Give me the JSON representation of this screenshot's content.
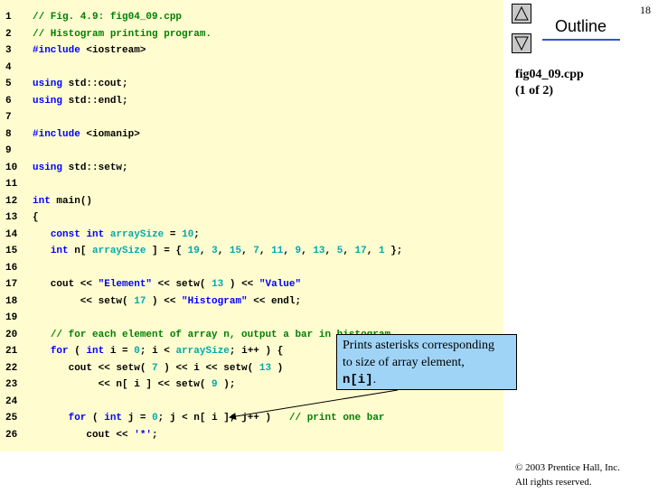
{
  "page_number": "18",
  "outline": {
    "title": "Outline",
    "up_icon": "triangle-up-icon",
    "down_icon": "triangle-down-icon",
    "file": "fig04_09.cpp",
    "part": "(1 of 2)"
  },
  "code_lines": [
    {
      "n": "1",
      "tokens": [
        {
          "t": "// Fig. 4.9: fig04_09.cpp",
          "c": "comment"
        }
      ]
    },
    {
      "n": "2",
      "tokens": [
        {
          "t": "// Histogram printing program.",
          "c": "comment"
        }
      ]
    },
    {
      "n": "3",
      "tokens": [
        {
          "t": "#include",
          "c": "keyword"
        },
        {
          "t": " <iostream>",
          "c": "plain"
        }
      ]
    },
    {
      "n": "4",
      "tokens": []
    },
    {
      "n": "5",
      "tokens": [
        {
          "t": "using",
          "c": "keyword"
        },
        {
          "t": " std::cout;",
          "c": "plain"
        }
      ]
    },
    {
      "n": "6",
      "tokens": [
        {
          "t": "using",
          "c": "keyword"
        },
        {
          "t": " std::endl;",
          "c": "plain"
        }
      ]
    },
    {
      "n": "7",
      "tokens": []
    },
    {
      "n": "8",
      "tokens": [
        {
          "t": "#include",
          "c": "keyword"
        },
        {
          "t": " <iomanip>",
          "c": "plain"
        }
      ]
    },
    {
      "n": "9",
      "tokens": []
    },
    {
      "n": "10",
      "tokens": [
        {
          "t": "using",
          "c": "keyword"
        },
        {
          "t": " std::setw;",
          "c": "plain"
        }
      ]
    },
    {
      "n": "11",
      "tokens": []
    },
    {
      "n": "12",
      "tokens": [
        {
          "t": "int",
          "c": "keyword"
        },
        {
          "t": " main()",
          "c": "plain"
        }
      ]
    },
    {
      "n": "13",
      "tokens": [
        {
          "t": "{",
          "c": "plain"
        }
      ]
    },
    {
      "n": "14",
      "tokens": [
        {
          "t": "   ",
          "c": "plain"
        },
        {
          "t": "const",
          "c": "keyword"
        },
        {
          "t": " ",
          "c": "plain"
        },
        {
          "t": "int",
          "c": "keyword"
        },
        {
          "t": " ",
          "c": "plain"
        },
        {
          "t": "arraySize",
          "c": "ident"
        },
        {
          "t": " = ",
          "c": "plain"
        },
        {
          "t": "10",
          "c": "number"
        },
        {
          "t": ";",
          "c": "plain"
        }
      ]
    },
    {
      "n": "15",
      "tokens": [
        {
          "t": "   ",
          "c": "plain"
        },
        {
          "t": "int",
          "c": "keyword"
        },
        {
          "t": " n[ ",
          "c": "plain"
        },
        {
          "t": "arraySize",
          "c": "ident"
        },
        {
          "t": " ] = { ",
          "c": "plain"
        },
        {
          "t": "19",
          "c": "number"
        },
        {
          "t": ", ",
          "c": "plain"
        },
        {
          "t": "3",
          "c": "number"
        },
        {
          "t": ", ",
          "c": "plain"
        },
        {
          "t": "15",
          "c": "number"
        },
        {
          "t": ", ",
          "c": "plain"
        },
        {
          "t": "7",
          "c": "number"
        },
        {
          "t": ", ",
          "c": "plain"
        },
        {
          "t": "11",
          "c": "number"
        },
        {
          "t": ", ",
          "c": "plain"
        },
        {
          "t": "9",
          "c": "number"
        },
        {
          "t": ", ",
          "c": "plain"
        },
        {
          "t": "13",
          "c": "number"
        },
        {
          "t": ", ",
          "c": "plain"
        },
        {
          "t": "5",
          "c": "number"
        },
        {
          "t": ", ",
          "c": "plain"
        },
        {
          "t": "17",
          "c": "number"
        },
        {
          "t": ", ",
          "c": "plain"
        },
        {
          "t": "1",
          "c": "number"
        },
        {
          "t": " };",
          "c": "plain"
        }
      ]
    },
    {
      "n": "16",
      "tokens": []
    },
    {
      "n": "17",
      "tokens": [
        {
          "t": "   cout << ",
          "c": "plain"
        },
        {
          "t": "\"Element\"",
          "c": "string"
        },
        {
          "t": " << setw( ",
          "c": "plain"
        },
        {
          "t": "13",
          "c": "number"
        },
        {
          "t": " ) << ",
          "c": "plain"
        },
        {
          "t": "\"Value\"",
          "c": "string"
        }
      ]
    },
    {
      "n": "18",
      "tokens": [
        {
          "t": "        << setw( ",
          "c": "plain"
        },
        {
          "t": "17",
          "c": "number"
        },
        {
          "t": " ) << ",
          "c": "plain"
        },
        {
          "t": "\"Histogram\"",
          "c": "string"
        },
        {
          "t": " << endl;",
          "c": "plain"
        }
      ]
    },
    {
      "n": "19",
      "tokens": []
    },
    {
      "n": "20",
      "tokens": [
        {
          "t": "   ",
          "c": "plain"
        },
        {
          "t": "// for each element of array n, output a bar in histogram",
          "c": "comment"
        }
      ]
    },
    {
      "n": "21",
      "tokens": [
        {
          "t": "   ",
          "c": "plain"
        },
        {
          "t": "for",
          "c": "keyword"
        },
        {
          "t": " ( ",
          "c": "plain"
        },
        {
          "t": "int",
          "c": "keyword"
        },
        {
          "t": " i = ",
          "c": "plain"
        },
        {
          "t": "0",
          "c": "number"
        },
        {
          "t": "; i < ",
          "c": "plain"
        },
        {
          "t": "arraySize",
          "c": "ident"
        },
        {
          "t": "; i++ ) {",
          "c": "plain"
        }
      ]
    },
    {
      "n": "22",
      "tokens": [
        {
          "t": "      cout << setw( ",
          "c": "plain"
        },
        {
          "t": "7",
          "c": "number"
        },
        {
          "t": " ) << i << setw( ",
          "c": "plain"
        },
        {
          "t": "13",
          "c": "number"
        },
        {
          "t": " )",
          "c": "plain"
        }
      ]
    },
    {
      "n": "23",
      "tokens": [
        {
          "t": "           << n[ i ] << setw( ",
          "c": "plain"
        },
        {
          "t": "9",
          "c": "number"
        },
        {
          "t": " );",
          "c": "plain"
        }
      ]
    },
    {
      "n": "24",
      "tokens": []
    },
    {
      "n": "25",
      "tokens": [
        {
          "t": "      ",
          "c": "plain"
        },
        {
          "t": "for",
          "c": "keyword"
        },
        {
          "t": " ( ",
          "c": "plain"
        },
        {
          "t": "int",
          "c": "keyword"
        },
        {
          "t": " j = ",
          "c": "plain"
        },
        {
          "t": "0",
          "c": "number"
        },
        {
          "t": "; j < n[ i ]; j++ )   ",
          "c": "plain"
        },
        {
          "t": "// print one bar",
          "c": "comment"
        }
      ]
    },
    {
      "n": "26",
      "tokens": [
        {
          "t": "         cout << ",
          "c": "plain"
        },
        {
          "t": "'*'",
          "c": "string"
        },
        {
          "t": ";",
          "c": "plain"
        }
      ]
    }
  ],
  "callout": {
    "text_1": "Prints asterisks corresponding",
    "text_2": "to size of array element,",
    "code": "n[i]",
    "suffix": "."
  },
  "copyright": {
    "line_1": "© 2003 Prentice Hall, Inc.",
    "line_2": "All rights reserved."
  }
}
